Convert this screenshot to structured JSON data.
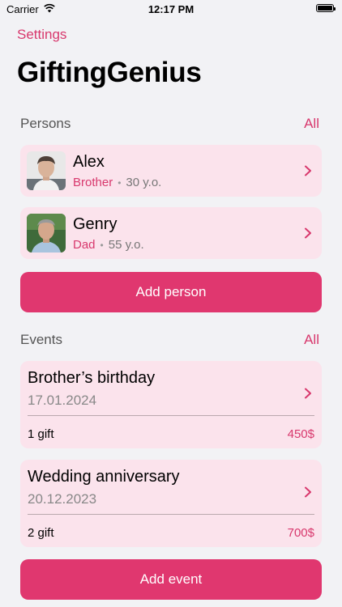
{
  "status_bar": {
    "carrier": "Carrier",
    "time": "12:17 PM"
  },
  "nav": {
    "back_label": "Settings",
    "title": "GiftingGenius"
  },
  "persons_section": {
    "title": "Persons",
    "all_label": "All",
    "items": [
      {
        "name": "Alex",
        "relation": "Brother",
        "separator": "•",
        "age": "30 y.o."
      },
      {
        "name": "Genry",
        "relation": "Dad",
        "separator": "•",
        "age": "55 y.o."
      }
    ],
    "add_label": "Add person"
  },
  "events_section": {
    "title": "Events",
    "all_label": "All",
    "items": [
      {
        "title": "Brother’s birthday",
        "date": "17.01.2024",
        "gifts": "1 gift",
        "price": "450$"
      },
      {
        "title": "Wedding anniversary",
        "date": "20.12.2023",
        "gifts": "2 gift",
        "price": "700$"
      }
    ],
    "add_label": "Add event"
  },
  "colors": {
    "accent": "#e0376f",
    "card_background": "#fbe3ec",
    "page_background": "#f2f2f5"
  }
}
